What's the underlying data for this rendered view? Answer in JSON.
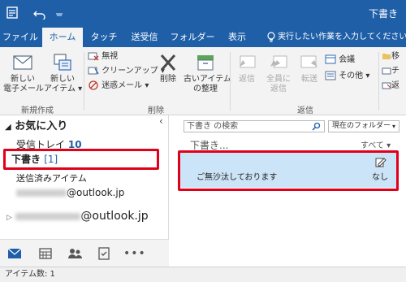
{
  "window": {
    "title": "下書き"
  },
  "tabs": [
    {
      "label": "ファイル"
    },
    {
      "label": "ホーム"
    },
    {
      "label": "タッチ"
    },
    {
      "label": "送受信"
    },
    {
      "label": "フォルダー"
    },
    {
      "label": "表示"
    }
  ],
  "tell_me": "実行したい作業を入力してください",
  "ribbon": {
    "new_email": "新しい\n電子メール",
    "new_items": "新しい\nアイテム ▾",
    "group_new": "新規作成",
    "ignore": "無視",
    "cleanup": "クリーンアップ ▾",
    "junk": "迷惑メール ▾",
    "delete": "削除",
    "archive": "古いアイテム\nの整理",
    "group_delete": "削除",
    "reply": "返信",
    "reply_all": "全員に\n返信",
    "forward": "転送",
    "meeting": "会議",
    "more": "その他 ▾",
    "group_respond": "返信",
    "move_cut": "移",
    "team_cut": "チ",
    "reply_cut": "返"
  },
  "nav": {
    "favorites": "お気に入り",
    "inbox": "受信トレイ",
    "inbox_count": "10",
    "drafts": "下書き",
    "drafts_count": "[1]",
    "sent": "送信済みアイテム",
    "account_domain": "@outlook.jp",
    "account2_domain": "@outlook.jp"
  },
  "list": {
    "search_placeholder": "下書き の検索",
    "scope": "現在のフォルダー",
    "folder_label": "下書き...",
    "filter": "すべて ▾",
    "item_subject": "ご無沙汰しております",
    "item_recipient": "なし"
  },
  "status": {
    "items": "アイテム数: 1"
  },
  "colors": {
    "accent": "#1e5fa8",
    "highlight": "#e0001a",
    "selected_row": "#cce4f7"
  }
}
